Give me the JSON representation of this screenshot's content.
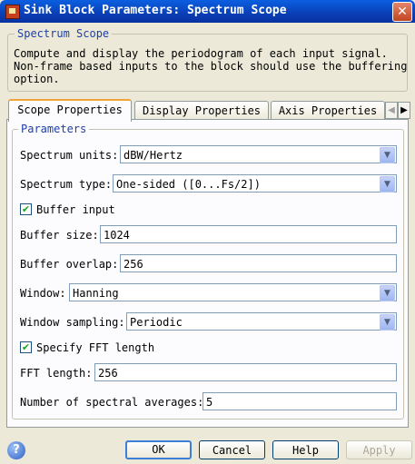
{
  "window": {
    "title": "Sink Block Parameters: Spectrum Scope",
    "close_glyph": "✕"
  },
  "block_group": {
    "legend": "Spectrum Scope",
    "description": "Compute and display the periodogram of each input signal.\nNon-frame based inputs to the block should use the buffering\noption."
  },
  "tabs": [
    {
      "label": "Scope Properties",
      "active": true
    },
    {
      "label": "Display Properties",
      "active": false
    },
    {
      "label": "Axis Properties",
      "active": false
    }
  ],
  "tab_scroll": {
    "left": "◀",
    "right": "▶"
  },
  "parameters": {
    "legend": "Parameters",
    "spectrum_units": {
      "label": "Spectrum units:",
      "value": "dBW/Hertz"
    },
    "spectrum_type": {
      "label": "Spectrum type:",
      "value": "One-sided ([0...Fs/2])"
    },
    "buffer_input": {
      "label": "Buffer input",
      "checked": true
    },
    "buffer_size": {
      "label": "Buffer size:",
      "value": "1024"
    },
    "buffer_overlap": {
      "label": "Buffer overlap:",
      "value": "256"
    },
    "window": {
      "label": "Window:",
      "value": "Hanning"
    },
    "window_sampling": {
      "label": "Window sampling:",
      "value": "Periodic"
    },
    "specify_fft": {
      "label": "Specify FFT length",
      "checked": true
    },
    "fft_length": {
      "label": "FFT length:",
      "value": "256"
    },
    "num_averages": {
      "label": "Number of spectral averages:",
      "value": "5"
    }
  },
  "buttons": {
    "help_icon": "?",
    "ok": "OK",
    "cancel": "Cancel",
    "help": "Help",
    "apply": "Apply"
  },
  "icons": {
    "check_glyph": "✔",
    "combo_glyph": "▼"
  },
  "colors": {
    "title_bar": "#0a3fb6",
    "legend_text": "#1f3fa6",
    "active_tab_accent": "#f1a33c"
  }
}
